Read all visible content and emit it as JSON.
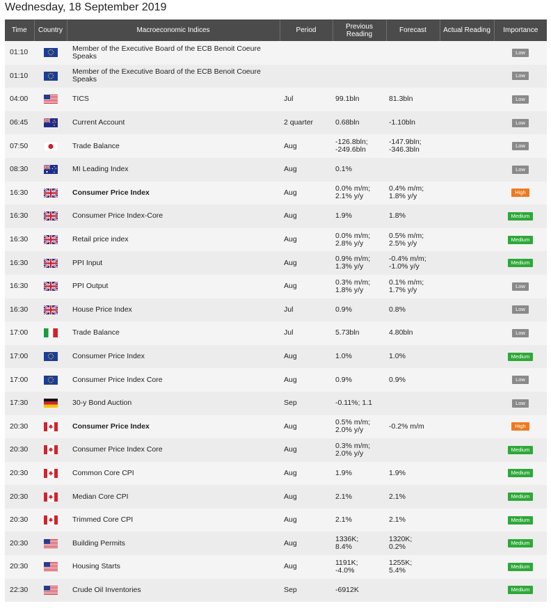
{
  "page_title": "Wednesday, 18 September 2019",
  "columns": {
    "time": "Time",
    "country": "Country",
    "indices": "Macroeconomic Indices",
    "period": "Period",
    "previous": "Previous Reading",
    "forecast": "Forecast",
    "actual": "Actual Reading",
    "importance": "Importance"
  },
  "rows": [
    {
      "time": "01:10",
      "flag": "eu-flag-icon",
      "indicator": "Member of the Executive Board of the ECB Benoit Coeure Speaks",
      "bold": false,
      "period": "",
      "previous": "",
      "forecast": "",
      "actual": "",
      "importance": "Low"
    },
    {
      "time": "01:10",
      "flag": "eu-flag-icon",
      "indicator": "Member of the Executive Board of the ECB Benoit Coeure Speaks",
      "bold": false,
      "period": "",
      "previous": "",
      "forecast": "",
      "actual": "",
      "importance": "Low"
    },
    {
      "time": "04:00",
      "flag": "us-flag-icon",
      "indicator": "TICS",
      "bold": false,
      "period": "Jul",
      "previous": "99.1bln",
      "forecast": "81.3bln",
      "actual": "",
      "importance": "Low"
    },
    {
      "time": "06:45",
      "flag": "nz-flag-icon",
      "indicator": "Current Account",
      "bold": false,
      "period": "2 quarter",
      "previous": "0.68bln",
      "forecast": "-1.10bln",
      "actual": "",
      "importance": "Low"
    },
    {
      "time": "07:50",
      "flag": "jp-flag-icon",
      "indicator": "Trade Balance",
      "bold": false,
      "period": "Aug",
      "previous": "-126.8bln;\n-249.6bln",
      "forecast": "-147.9bln;\n-346.3bln",
      "actual": "",
      "importance": "Low"
    },
    {
      "time": "08:30",
      "flag": "au-flag-icon",
      "indicator": "MI Leading Index",
      "bold": false,
      "period": "Aug",
      "previous": "0.1%",
      "forecast": "",
      "actual": "",
      "importance": "Low"
    },
    {
      "time": "16:30",
      "flag": "uk-flag-icon",
      "indicator": "Consumer Price Index",
      "bold": true,
      "period": "Aug",
      "previous": "0.0% m/m;\n2.1% y/y",
      "forecast": "0.4% m/m;\n1.8% y/y",
      "actual": "",
      "importance": "High"
    },
    {
      "time": "16:30",
      "flag": "uk-flag-icon",
      "indicator": "Consumer Price Index-Core",
      "bold": false,
      "period": "Aug",
      "previous": "1.9%",
      "forecast": "1.8%",
      "actual": "",
      "importance": "Medium"
    },
    {
      "time": "16:30",
      "flag": "uk-flag-icon",
      "indicator": "Retail price index",
      "bold": false,
      "period": "Aug",
      "previous": "0.0% m/m;\n2.8% y/y",
      "forecast": "0.5% m/m;\n2.5% y/y",
      "actual": "",
      "importance": "Medium"
    },
    {
      "time": "16:30",
      "flag": "uk-flag-icon",
      "indicator": "PPI Input",
      "bold": false,
      "period": "Aug",
      "previous": "0.9% m/m;\n1.3% y/y",
      "forecast": "-0.4% m/m;\n-1.0% y/y",
      "actual": "",
      "importance": "Medium"
    },
    {
      "time": "16:30",
      "flag": "uk-flag-icon",
      "indicator": "PPI Output",
      "bold": false,
      "period": "Aug",
      "previous": "0.3% m/m;\n1.8% y/y",
      "forecast": "0.1% m/m;\n1.7% y/y",
      "actual": "",
      "importance": "Low"
    },
    {
      "time": "16:30",
      "flag": "uk-flag-icon",
      "indicator": "House Price Index",
      "bold": false,
      "period": "Jul",
      "previous": "0.9%",
      "forecast": "0.8%",
      "actual": "",
      "importance": "Low"
    },
    {
      "time": "17:00",
      "flag": "it-flag-icon",
      "indicator": "Trade Balance",
      "bold": false,
      "period": "Jul",
      "previous": "5.73bln",
      "forecast": "4.80bln",
      "actual": "",
      "importance": "Low"
    },
    {
      "time": "17:00",
      "flag": "eu-flag-icon",
      "indicator": "Consumer Price Index",
      "bold": false,
      "period": "Aug",
      "previous": "1.0%",
      "forecast": "1.0%",
      "actual": "",
      "importance": "Medium"
    },
    {
      "time": "17:00",
      "flag": "eu-flag-icon",
      "indicator": "Consumer Price Index Core",
      "bold": false,
      "period": "Aug",
      "previous": "0.9%",
      "forecast": "0.9%",
      "actual": "",
      "importance": "Low"
    },
    {
      "time": "17:30",
      "flag": "de-flag-icon",
      "indicator": "30-y Bond Auction",
      "bold": false,
      "period": "Sep",
      "previous": "-0.11%; 1.1",
      "forecast": "",
      "actual": "",
      "importance": "Low"
    },
    {
      "time": "20:30",
      "flag": "ca-flag-icon",
      "indicator": "Consumer Price Index",
      "bold": true,
      "period": "Aug",
      "previous": "0.5% m/m;\n2.0% y/y",
      "forecast": "-0.2% m/m",
      "actual": "",
      "importance": "High"
    },
    {
      "time": "20:30",
      "flag": "ca-flag-icon",
      "indicator": "Consumer Price Index Core",
      "bold": false,
      "period": "Aug",
      "previous": "0.3% m/m;\n2.0% y/y",
      "forecast": "",
      "actual": "",
      "importance": "Medium"
    },
    {
      "time": "20:30",
      "flag": "ca-flag-icon",
      "indicator": "Common Core CPI",
      "bold": false,
      "period": "Aug",
      "previous": "1.9%",
      "forecast": "1.9%",
      "actual": "",
      "importance": "Medium"
    },
    {
      "time": "20:30",
      "flag": "ca-flag-icon",
      "indicator": "Median Core CPI",
      "bold": false,
      "period": "Aug",
      "previous": "2.1%",
      "forecast": "2.1%",
      "actual": "",
      "importance": "Medium"
    },
    {
      "time": "20:30",
      "flag": "ca-flag-icon",
      "indicator": "Trimmed Core CPI",
      "bold": false,
      "period": "Aug",
      "previous": "2.1%",
      "forecast": "2.1%",
      "actual": "",
      "importance": "Medium"
    },
    {
      "time": "20:30",
      "flag": "us-flag-icon",
      "indicator": "Building Permits",
      "bold": false,
      "period": "Aug",
      "previous": "1336K;\n8.4%",
      "forecast": "1320K;\n0.2%",
      "actual": "",
      "importance": "Medium"
    },
    {
      "time": "20:30",
      "flag": "us-flag-icon",
      "indicator": "Housing Starts",
      "bold": false,
      "period": "Aug",
      "previous": "1191K;\n-4.0%",
      "forecast": "1255K;\n5.4%",
      "actual": "",
      "importance": "Medium"
    },
    {
      "time": "22:30",
      "flag": "us-flag-icon",
      "indicator": "Crude Oil Inventories",
      "bold": false,
      "period": "Sep",
      "previous": "-6912K",
      "forecast": "",
      "actual": "",
      "importance": "Medium"
    }
  ],
  "colors": {
    "header_bg": "#4b4b4b",
    "row_odd": "#f4f4f4",
    "row_even": "#ececec",
    "low": "#8a8a8a",
    "medium": "#2ea838",
    "high": "#ee7a1e"
  }
}
